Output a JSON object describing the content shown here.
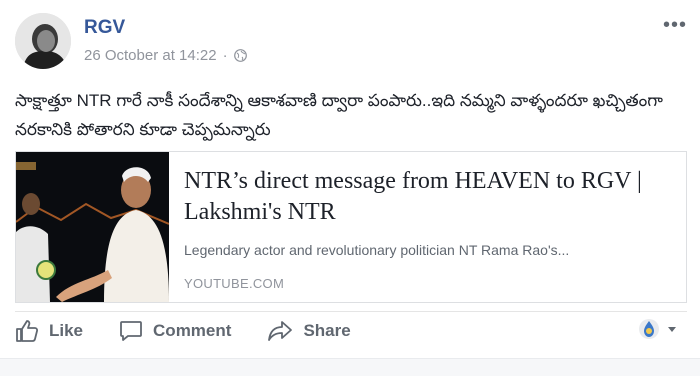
{
  "post": {
    "author": "RGV",
    "timestamp": "26 October at 14:22",
    "separator": "·",
    "privacy_icon": "globe-icon",
    "more_label": "•••",
    "text": "సాక్షాత్తూ NTR గారే నాకీ సందేశాన్ని ఆకాశవాణి ద్వారా పంపారు..ఇది నమ్మని వాళ్ళందరూ ఖచ్చితంగా నరకానికి పోతారని కూడా చెప్పమన్నారు"
  },
  "link": {
    "title": "NTR’s direct message from HEAVEN to RGV | Lakshmi's NTR",
    "description": "Legendary actor and revolutionary politician NT Rama Rao's...",
    "domain": "YOUTUBE.COM"
  },
  "actions": {
    "like": "Like",
    "comment": "Comment",
    "share": "Share"
  },
  "colors": {
    "author": "#365899",
    "secondary_text": "#90949c",
    "action_text": "#606770"
  }
}
